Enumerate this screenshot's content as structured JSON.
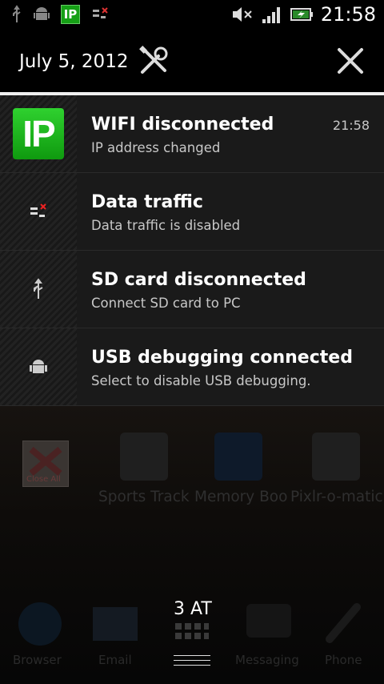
{
  "status_bar": {
    "left_icons": [
      "usb-icon",
      "android-debug-icon",
      "ip-icon",
      "data-traffic-icon"
    ],
    "ip_label": "IP",
    "right_icons": [
      "mute-icon",
      "signal-icon",
      "battery-charging-icon"
    ],
    "time": "21:58"
  },
  "header": {
    "date": "July 5, 2012"
  },
  "notifications": [
    {
      "title": "WIFI disconnected",
      "subtitle": "IP address changed",
      "time": "21:58",
      "icon": "ip-icon",
      "icon_label": "IP"
    },
    {
      "title": "Data traffic",
      "subtitle": "Data traffic is disabled",
      "icon": "data-traffic-icon"
    },
    {
      "title": "SD card disconnected",
      "subtitle": "Connect SD card to PC",
      "icon": "usb-icon"
    },
    {
      "title": "USB debugging connected",
      "subtitle": "Select to disable USB debugging.",
      "icon": "android-debug-icon"
    }
  ],
  "background": {
    "close_all_label": "Close All",
    "recent_apps": [
      "Sports Track",
      "Memory Boo",
      "Pixlr-o-matic"
    ],
    "dock": {
      "tab_count": "3 AT",
      "apps": [
        "Browser",
        "Email",
        "Messaging",
        "Phone"
      ]
    }
  },
  "colors": {
    "accent_green": "#16a016",
    "panel_bg": "#1a1a1a",
    "header_rule": "#f0f0f0"
  }
}
